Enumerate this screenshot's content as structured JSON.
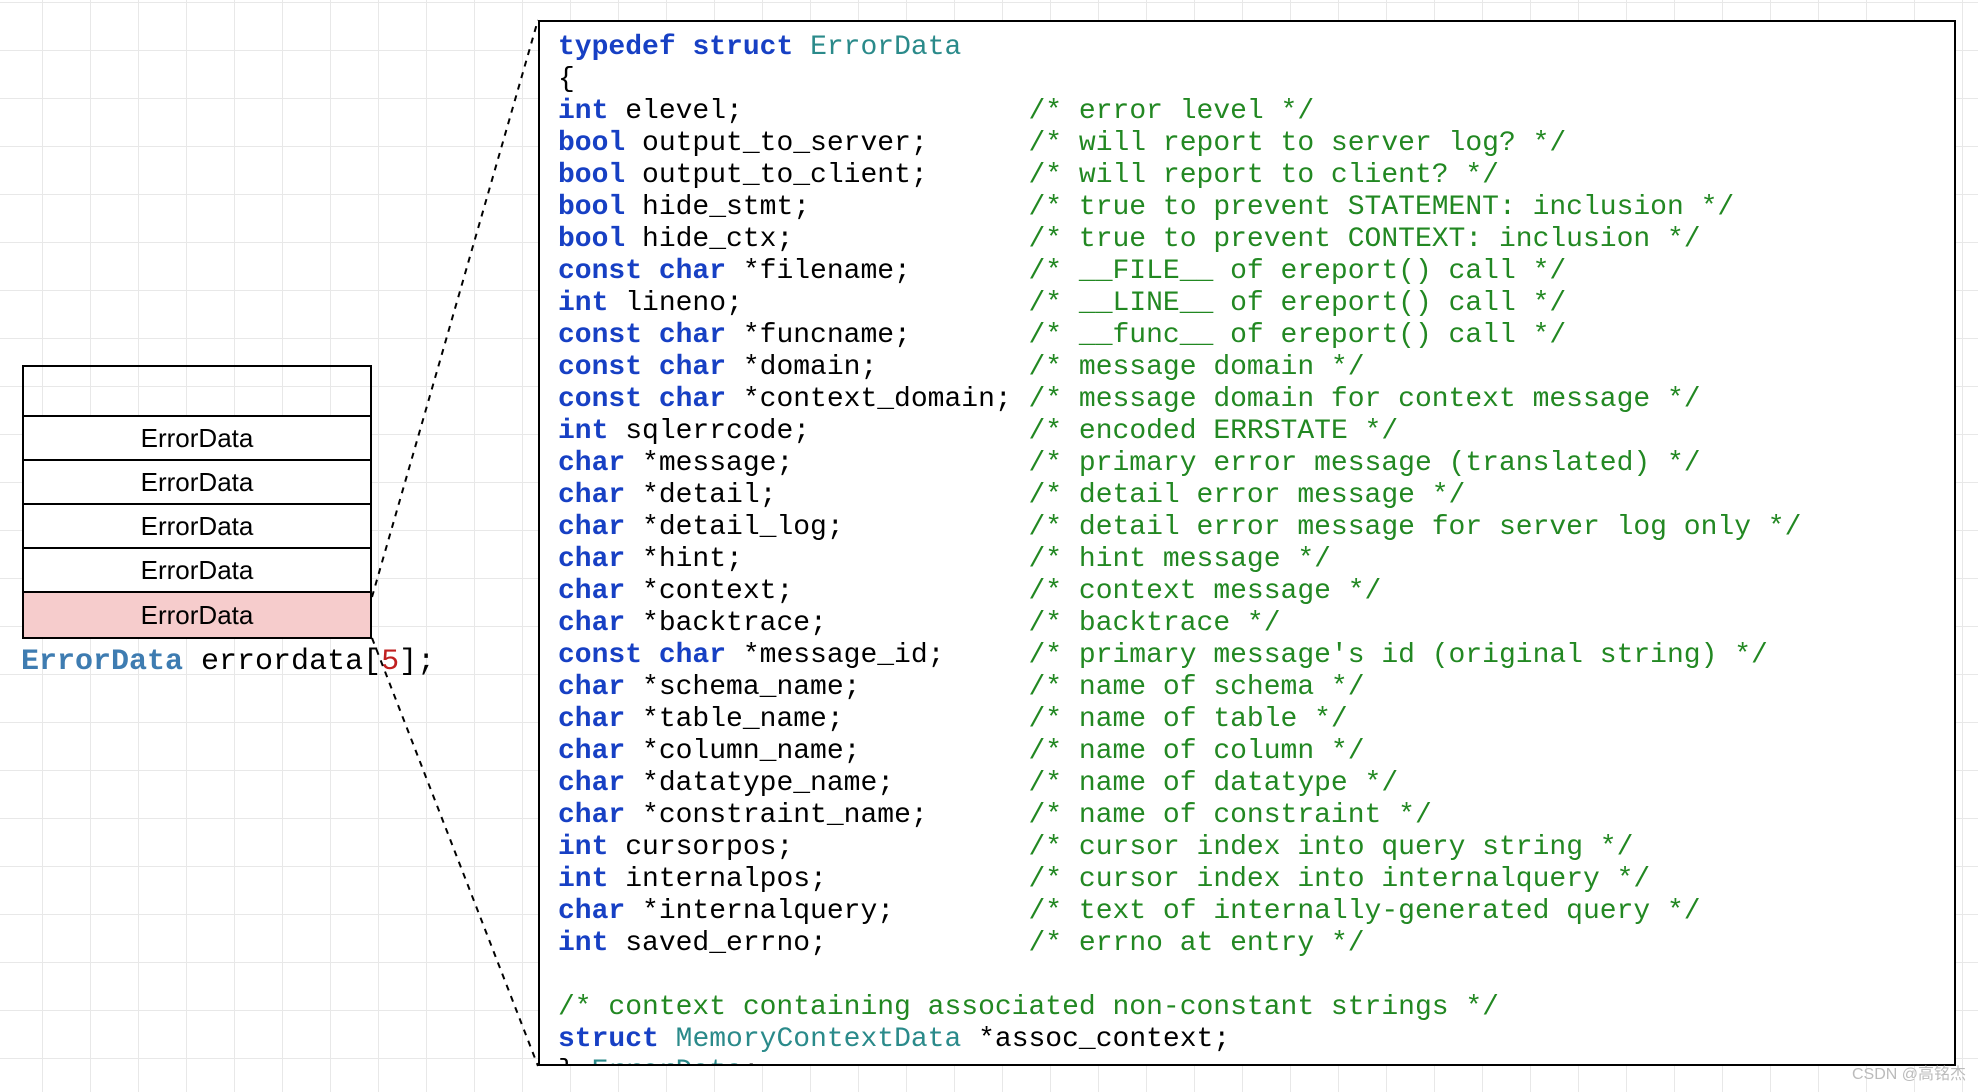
{
  "stack": {
    "rows": [
      "ErrorData",
      "ErrorData",
      "ErrorData",
      "ErrorData",
      "ErrorData"
    ]
  },
  "decl": {
    "type": "ErrorData",
    "name": "errordata",
    "size": "5"
  },
  "code": {
    "typedef_kw": "typedef",
    "struct_kw": "struct",
    "struct_name": "ErrorData",
    "open": "{",
    "close_name": "ErrorData",
    "trailing_comment": "/* context containing associated non-constant strings */",
    "assoc_line_struct": "struct",
    "assoc_line_type": "MemoryContextData",
    "assoc_line_rest": "*assoc_context;",
    "fields": [
      {
        "t": "int",
        "n": "elevel;",
        "c": "/* error level */"
      },
      {
        "t": "bool",
        "n": "output_to_server;",
        "c": "/* will report to server log? */"
      },
      {
        "t": "bool",
        "n": "output_to_client;",
        "c": "/* will report to client? */"
      },
      {
        "t": "bool",
        "n": "hide_stmt;",
        "c": "/* true to prevent STATEMENT: inclusion */"
      },
      {
        "t": "bool",
        "n": "hide_ctx;",
        "c": "/* true to prevent CONTEXT: inclusion */"
      },
      {
        "t": "const char",
        "n": "*filename;",
        "c": "/* __FILE__ of ereport() call */"
      },
      {
        "t": "int",
        "n": "lineno;",
        "c": "/* __LINE__ of ereport() call */"
      },
      {
        "t": "const char",
        "n": "*funcname;",
        "c": "/* __func__ of ereport() call */"
      },
      {
        "t": "const char",
        "n": "*domain;",
        "c": "/* message domain */"
      },
      {
        "t": "const char",
        "n": "*context_domain;",
        "c": "/* message domain for context message */"
      },
      {
        "t": "int",
        "n": "sqlerrcode;",
        "c": "/* encoded ERRSTATE */"
      },
      {
        "t": "char",
        "n": "*message;",
        "c": "/* primary error message (translated) */"
      },
      {
        "t": "char",
        "n": "*detail;",
        "c": "/* detail error message */"
      },
      {
        "t": "char",
        "n": "*detail_log;",
        "c": "/* detail error message for server log only */"
      },
      {
        "t": "char",
        "n": "*hint;",
        "c": "/* hint message */"
      },
      {
        "t": "char",
        "n": "*context;",
        "c": "/* context message */"
      },
      {
        "t": "char",
        "n": "*backtrace;",
        "c": "/* backtrace */"
      },
      {
        "t": "const char",
        "n": "*message_id;",
        "c": "/* primary message's id (original string) */"
      },
      {
        "t": "char",
        "n": "*schema_name;",
        "c": "/* name of schema */"
      },
      {
        "t": "char",
        "n": "*table_name;",
        "c": "/* name of table */"
      },
      {
        "t": "char",
        "n": "*column_name;",
        "c": "/* name of column */"
      },
      {
        "t": "char",
        "n": "*datatype_name;",
        "c": "/* name of datatype */"
      },
      {
        "t": "char",
        "n": "*constraint_name;",
        "c": "/* name of constraint */"
      },
      {
        "t": "int",
        "n": "cursorpos;",
        "c": "/* cursor index into query string */"
      },
      {
        "t": "int",
        "n": "internalpos;",
        "c": "/* cursor index into internalquery */"
      },
      {
        "t": "char",
        "n": "*internalquery;",
        "c": "/* text of internally-generated query */"
      },
      {
        "t": "int",
        "n": "saved_errno;",
        "c": "/* errno at entry */"
      }
    ]
  },
  "watermark": "CSDN @高铭杰"
}
